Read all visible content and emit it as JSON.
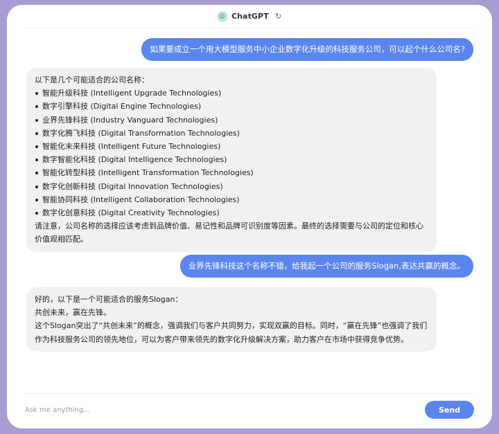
{
  "app": {
    "title": "ChatGPT",
    "refresh_icon": "refresh-icon",
    "logo_icon": "chatgpt-logo-icon"
  },
  "messages": {
    "q1": "如果要成立一个用大模型服务中小企业数字化升级的科技服务公司，可以起个什么公司名?",
    "a1": {
      "intro": "以下是几个可能适合的公司名称：",
      "items": [
        "智能升级科技 (Intelligent Upgrade Technologies)",
        "数字引擎科技 (Digital Engine Technologies)",
        "业界先锋科技 (Industry Vanguard Technologies)",
        "数字化腾飞科技 (Digital Transformation Technologies)",
        "智能化未来科技 (Intelligent Future Technologies)",
        "数字智能化科技 (Digital Intelligence Technologies)",
        "智能化转型科技 (Intelligent Transformation Technologies)",
        "数字化创新科技 (Digital Innovation Technologies)",
        "智能协同科技 (Intelligent Collaboration Technologies)",
        "数字化创意科技 (Digital Creativity Technologies)"
      ],
      "outro": "请注意，公司名称的选择应该考虑到品牌价值、易记性和品牌可识别度等因素。最终的选择需要与公司的定位和核心价值观相匹配。"
    },
    "q2": "业界先锋科技这个名称不错，给我起一个公司的服务Slogan,表达共赢的概念。",
    "a2": {
      "intro": "好的，以下是一个可能适合的服务Slogan：",
      "slogan": "共创未来，赢在先锋。",
      "explanation": "这个Slogan突出了“共创未来”的概念，强调我们与客户共同努力，实现双赢的目标。同时，“赢在先锋”也强调了我们作为科技服务公司的领先地位，可以为客户带来领先的数字化升级解决方案，助力客户在市场中获得竞争优势。"
    }
  },
  "composer": {
    "placeholder": "Ask me anything...",
    "send_label": "Send"
  },
  "colors": {
    "accent": "#5b86f0",
    "assistant_bubble": "#f1f1f3",
    "frame": "#a99bd3"
  }
}
